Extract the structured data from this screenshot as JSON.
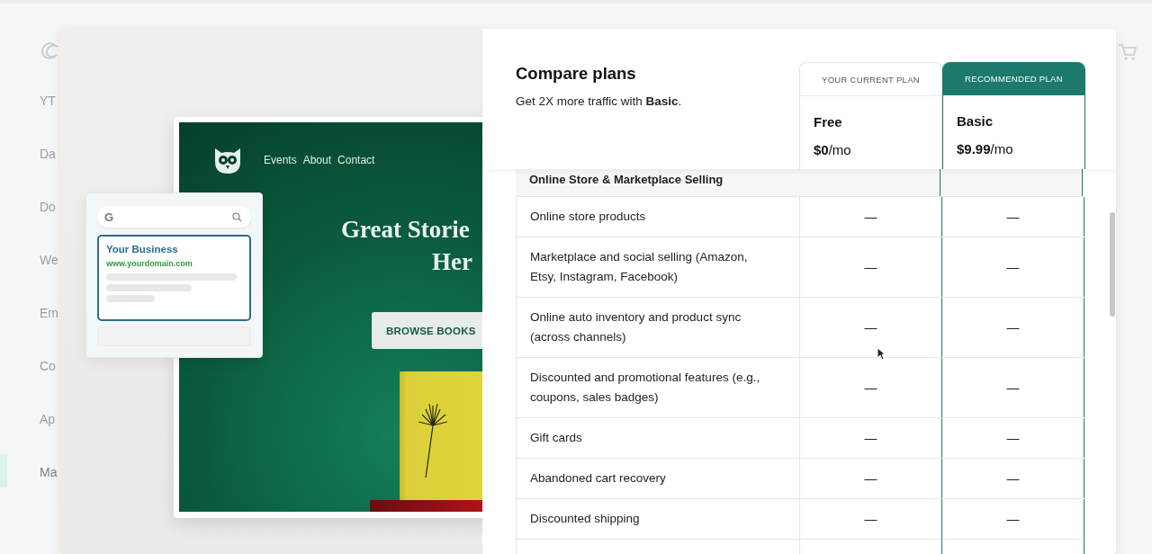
{
  "background": {
    "sidebar_items": [
      {
        "label": "YT",
        "selected": false
      },
      {
        "label": "Da",
        "selected": false
      },
      {
        "label": "Do",
        "selected": false
      },
      {
        "label": "We",
        "selected": false
      },
      {
        "label": "Em",
        "selected": false
      },
      {
        "label": "Co",
        "selected": false
      },
      {
        "label": "Ap",
        "selected": false
      },
      {
        "label": "Ma",
        "selected": true
      }
    ]
  },
  "illustration": {
    "site_nav": [
      "Events",
      "About",
      "Contact"
    ],
    "headline_lines": [
      "Great Storie",
      "Her"
    ],
    "cta": "BROWSE BOOKS",
    "search_card": {
      "search_letter": "G",
      "result_title": "Your Business",
      "result_url": "www.yourdomain.com"
    }
  },
  "compare": {
    "title": "Compare plans",
    "subtitle": "Get 2X more traffic with **Basic**.",
    "plans": [
      {
        "badge": "YOUR CURRENT PLAN",
        "name": "Free",
        "price": "$0",
        "period": "/mo",
        "recommended": false
      },
      {
        "badge": "RECOMMENDED PLAN",
        "name": "Basic",
        "price": "$9.99",
        "period": "/mo",
        "recommended": true
      }
    ],
    "section": "Online Store & Marketplace Selling",
    "rows": [
      {
        "feature": "Online store products",
        "values": [
          "—",
          "—"
        ]
      },
      {
        "feature": "Marketplace and social selling (Amazon, Etsy, Instagram, Facebook)",
        "values": [
          "—",
          "—"
        ]
      },
      {
        "feature": "Online auto inventory and product sync (across channels)",
        "values": [
          "—",
          "—"
        ]
      },
      {
        "feature": "Discounted and promotional features (e.g., coupons, sales badges)",
        "values": [
          "—",
          "—"
        ]
      },
      {
        "feature": "Gift cards",
        "values": [
          "—",
          "—"
        ]
      },
      {
        "feature": "Abandoned cart recovery",
        "values": [
          "—",
          "—"
        ]
      },
      {
        "feature": "Discounted shipping",
        "values": [
          "—",
          "—"
        ]
      }
    ]
  }
}
